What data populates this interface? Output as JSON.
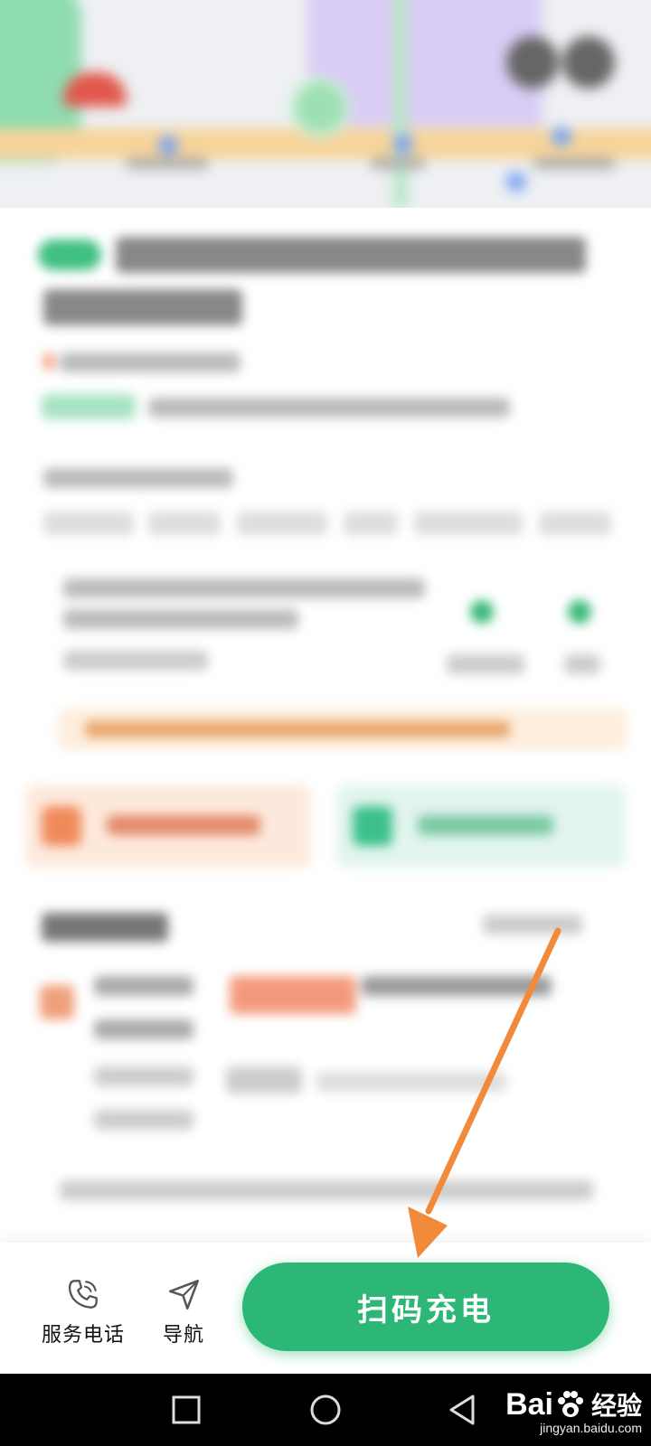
{
  "bottom_bar": {
    "service_phone_label": "服务电话",
    "navigate_label": "导航",
    "scan_charge_label": "扫码充电"
  },
  "watermark": {
    "brand_left": "Bai",
    "brand_right": "经验",
    "site": "jingyan.baidu.com"
  },
  "colors": {
    "accent_green": "#2cb776",
    "annotation_arrow": "#f28a3c",
    "price_orange": "#f06a3c"
  },
  "icons": {
    "service_phone": "phone-icon",
    "navigate": "navigate-arrow-icon",
    "nav_recents": "square-icon",
    "nav_home": "circle-icon",
    "nav_back": "triangle-back-icon"
  }
}
